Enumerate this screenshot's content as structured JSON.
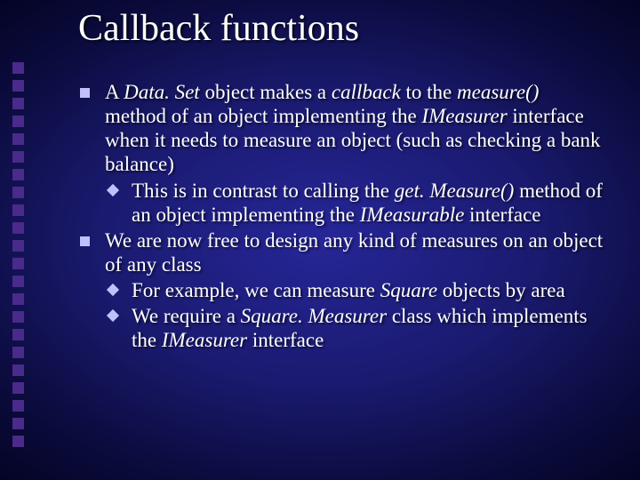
{
  "title": "Callback functions",
  "b1": {
    "seg1": "A ",
    "seg2": "Data. Set",
    "seg3": " object makes a ",
    "seg4": "callback",
    "seg5": " to the ",
    "seg6": "measure()",
    "seg7": " method  of an object implementing the ",
    "seg8": "IMeasurer",
    "seg9": " interface when it needs to measure an object (such as checking a bank balance)"
  },
  "b1a": {
    "seg1": "This is in contrast to calling the ",
    "seg2": "get. Measure()",
    "seg3": " method of an object implementing the ",
    "seg4": "IMeasurable",
    "seg5": " interface"
  },
  "b2": {
    "seg1": "We are now free to design any kind of measures on an object of any class"
  },
  "b2a": {
    "seg1": "For example, we can measure ",
    "seg2": "Square",
    "seg3": " objects by area"
  },
  "b2b": {
    "seg1": "We require a ",
    "seg2": "Square. Measurer",
    "seg3": " class which implements the ",
    "seg4": "IMeasurer",
    "seg5": " interface"
  }
}
